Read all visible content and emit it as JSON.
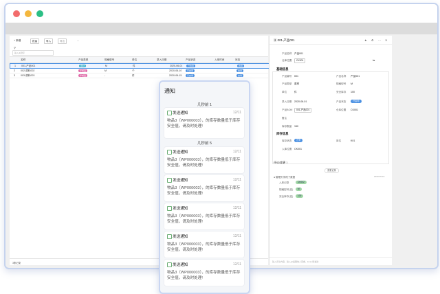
{
  "colors": {
    "close": "#f26c6c",
    "minimize": "#f4b73e",
    "maximize": "#2bbf85",
    "accent": "#4a90e2",
    "pink": "#e06aa8",
    "teal": "#3bb0c9"
  },
  "toolbar": {
    "new": "新增",
    "batch": "批量",
    "import": "导入",
    "export": "导出",
    "more": "..."
  },
  "filter": {
    "placeholder": "输入关键字"
  },
  "table": {
    "headers": [
      "名称",
      "产品类型",
      "规格型号",
      "单位",
      "录入日期",
      "产品状态",
      "入库时间",
      "备注",
      "状态"
    ],
    "rows": [
      {
        "idx": "1",
        "name": "001-产品001",
        "type": "原材",
        "spec": "M",
        "unit": "件",
        "date": "2020-06-01",
        "status": "已启用",
        "state": "启用"
      },
      {
        "idx": "2",
        "name": "002-原料002",
        "type": "半成品",
        "spec": "M",
        "unit": "个",
        "date": "2020-06-10",
        "status": "已启用",
        "state": "启用"
      },
      {
        "idx": "3",
        "name": "003-原料003",
        "type": "半成品",
        "spec": "-",
        "unit": "件",
        "date": "2020-06-15",
        "status": "已启用",
        "state": "启用"
      }
    ],
    "footer": "3条记录"
  },
  "detail": {
    "title": "001-产品001",
    "top": [
      {
        "label": "产品名称",
        "value": "产品001"
      },
      {
        "label": "仓库位置",
        "value": "CK001"
      }
    ],
    "section1": "基础信息",
    "fields": [
      {
        "l1": "产品编号",
        "v1": "001",
        "l2": "产品名称",
        "v2": "产品001"
      },
      {
        "l1": "产品类型",
        "v1": "原材",
        "l2": "规格型号",
        "v2": "M"
      },
      {
        "l1": "单位",
        "v1": "件",
        "l2": "安全库存",
        "v2": "100"
      },
      {
        "l1": "录入日期",
        "v1": "2020-06-01",
        "l2": "产品状态",
        "v2": "已启用"
      },
      {
        "l1": "产品BOM",
        "v1": "001-产品001",
        "l2": "仓库位置",
        "v2": "CK001"
      },
      {
        "l1": "备注",
        "v1": "",
        "l2": "",
        "v2": ""
      },
      {
        "l1": "库存数量",
        "v1": "150",
        "l2": "",
        "v2": ""
      }
    ],
    "section2": "库存信息",
    "stock": [
      {
        "label": "库存状态",
        "value": "正常"
      },
      {
        "label": "库位",
        "value": "K01"
      },
      {
        "label": "入库位置",
        "value": "CK001"
      }
    ],
    "comments_title": "评论/变更",
    "comments_count": "3",
    "history_badge": "变更记录",
    "log_user": "管理员 修改了数据",
    "log_time": "2020-06-10",
    "log_items": [
      {
        "label": "入库记录",
        "from": "CK001",
        "to": "CK002"
      },
      {
        "label": "规格型号(旧)",
        "from": "S",
        "to": "M"
      },
      {
        "label": "安全库存(旧)",
        "from": "50",
        "to": "100"
      }
    ],
    "comment_placeholder": "输入评论内容，输入@提醒他人查看，Enter键发送"
  },
  "notifications": {
    "title": "通知",
    "groups": [
      {
        "label": "几秒前 1",
        "items": [
          {
            "title": "发送通知",
            "date": "12/11",
            "body": "物品3（WP000003），的库存数量低于库存安全值，请及时处理!"
          }
        ]
      },
      {
        "label": "几秒前 5",
        "items": [
          {
            "title": "发送通知",
            "date": "12/11",
            "body": "物品3（WP000003），的库存数量低于库存安全值，请及时处理!"
          },
          {
            "title": "发送通知",
            "date": "12/11",
            "body": "物品3（WP000003），的库存数量低于库存安全值，请及时处理!"
          },
          {
            "title": "发送通知",
            "date": "12/11",
            "body": "物品3（WP000003），的库存数量低于库存安全值，请及时处理!"
          },
          {
            "title": "发送通知",
            "date": "12/11",
            "body": "物品3（WP000003），的库存数量低于库存安全值，请及时处理!"
          },
          {
            "title": "发送通知",
            "date": "12/11",
            "body": "物品3（WP000003），的库存数量低于库存安全值，请及时处理!"
          }
        ]
      }
    ]
  }
}
